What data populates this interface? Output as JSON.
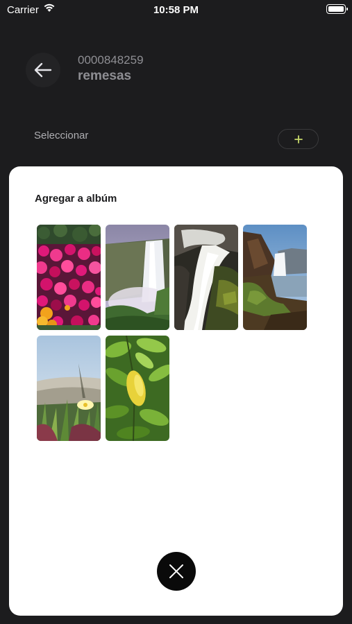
{
  "status_bar": {
    "carrier": "Carrier",
    "time": "10:58 PM",
    "icons": [
      "wifi-icon",
      "battery-icon"
    ]
  },
  "header": {
    "back_icon": "arrow-left-icon",
    "account_number": "0000848259",
    "account_name": "remesas"
  },
  "select_row": {
    "label": "Seleccionar",
    "add_icon": "plus-icon",
    "accent_color": "#c7d96b"
  },
  "sheet": {
    "title": "Agregar a albúm",
    "photos": [
      {
        "subject": "pink-flowers"
      },
      {
        "subject": "waterfall-cliff"
      },
      {
        "subject": "waterfall-rocks"
      },
      {
        "subject": "waterfall-coast"
      },
      {
        "subject": "beach-dune-flower"
      },
      {
        "subject": "lemon-leaves"
      }
    ],
    "close_icon": "close-icon"
  },
  "colors": {
    "background": "#1c1c1e",
    "sheet": "#ffffff",
    "close_button": "#0a0a0a"
  }
}
